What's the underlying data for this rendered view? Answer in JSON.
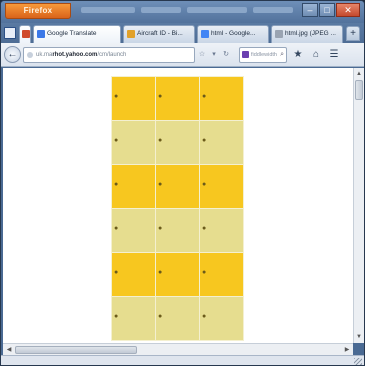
{
  "browser": {
    "app_button_label": "Firefox",
    "window_controls": {
      "minimize": "–",
      "maximize": "□",
      "close": "✕"
    }
  },
  "tabs": [
    {
      "label": "Google Translate",
      "icon": "google-translate-icon",
      "color": "#3b78e7"
    },
    {
      "label": "Aircraft ID - Bi...",
      "icon": "aircraft-icon",
      "color": "#e1a12a"
    },
    {
      "label": "html - Google...",
      "icon": "google-icon",
      "color": "#4285f4"
    },
    {
      "label": "html.jpg (JPEG ...",
      "icon": "image-icon",
      "color": "#9aa4b2"
    }
  ],
  "new_tab_label": "+",
  "navigation": {
    "back_icon": "←",
    "url_prefix": "uk.ma",
    "url_domain": "rhot.yahoo.com",
    "url_suffix": "/cm/launch",
    "reload_icon": "↻",
    "search_placeholder": "fiddlewidth",
    "bookmark_icon": "★",
    "home_icon": "⌂",
    "menu_icon": "☰"
  },
  "content": {
    "row_colors": [
      "#f7c71f",
      "#e6dd8f"
    ],
    "rows": [
      {
        "style": "gold",
        "cells": [
          "●",
          "●",
          "●"
        ]
      },
      {
        "style": "khaki",
        "cells": [
          "●",
          "●",
          "●"
        ]
      },
      {
        "style": "gold",
        "cells": [
          "●",
          "●",
          "●"
        ]
      },
      {
        "style": "khaki",
        "cells": [
          "●",
          "●",
          "●"
        ]
      },
      {
        "style": "gold",
        "cells": [
          "●",
          "●",
          "●"
        ]
      },
      {
        "style": "khaki",
        "cells": [
          "●",
          "●",
          "●"
        ]
      }
    ]
  },
  "scrollbars": {
    "up": "▲",
    "down": "▼",
    "left": "◀",
    "right": "▶"
  }
}
